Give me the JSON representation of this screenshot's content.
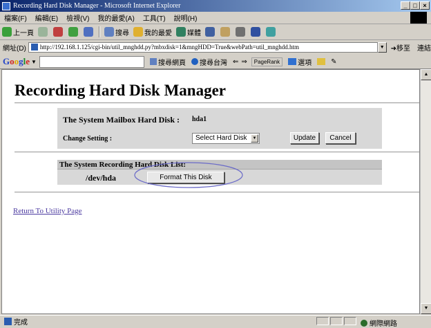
{
  "window": {
    "title": "Recording Hard Disk Manager - Microsoft Internet Explorer",
    "controls": [
      "_",
      "□",
      "×"
    ]
  },
  "menu": {
    "items": [
      "檔案(F)",
      "編輯(E)",
      "檢視(V)",
      "我的最愛(A)",
      "工具(T)",
      "說明(H)"
    ]
  },
  "toolbar": {
    "back": "上一頁",
    "search": "搜尋",
    "favorites": "我的最愛",
    "media": "媒體"
  },
  "address": {
    "label": "網址(D)",
    "url": "http://192.168.1.125/cgi-bin/util_mnghdd.py?mbxdisk=1&mngHDD=True&webPath=util_mnghdd.htm",
    "go": "移至",
    "links": "連結"
  },
  "google": {
    "search_web": "搜尋網頁",
    "search_tw": "搜尋台灣",
    "pagerank": "PageRank",
    "options": "選項"
  },
  "page": {
    "title": "Recording Hard Disk Manager",
    "mailbox_label": "The System Mailbox Hard Disk :",
    "mailbox_value": "hda1",
    "change_label": "Change Setting :",
    "select_value": "Select Hard Disk",
    "update_label": "Update",
    "cancel_label": "Cancel",
    "list_header": "The System Recording Hard Disk List:",
    "device": "/dev/hda",
    "format_label": "Format This Disk",
    "return_link": "Return To Utility Page"
  },
  "status": {
    "text": "完成",
    "zone": "網際網路"
  },
  "colors": {
    "titlebar": "#0a246a",
    "panel": "#d8d8d8",
    "link": "#4b3aa0",
    "highlight": "#6a6ac8"
  }
}
